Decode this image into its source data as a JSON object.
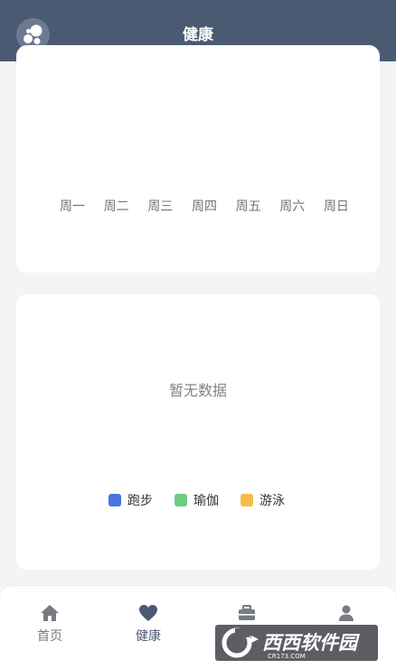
{
  "header": {
    "title": "健康",
    "logo_icon": "bubbles-logo-icon"
  },
  "weekly_chart": {
    "days": [
      "周一",
      "周二",
      "周三",
      "周四",
      "周五",
      "周六",
      "周日"
    ]
  },
  "sport_chart": {
    "empty_text": "暂无数据",
    "legend": [
      {
        "label": "跑步",
        "color": "#4a72e0"
      },
      {
        "label": "瑜伽",
        "color": "#6ccd7e"
      },
      {
        "label": "游泳",
        "color": "#f6bc45"
      }
    ]
  },
  "tabbar": {
    "items": [
      {
        "label": "首页",
        "icon": "home-icon",
        "active": false
      },
      {
        "label": "健康",
        "icon": "heart-icon",
        "active": true
      },
      {
        "label": "",
        "icon": "toolbox-icon",
        "active": false
      },
      {
        "label": "",
        "icon": "user-icon",
        "active": false
      }
    ]
  },
  "watermark": {
    "text": "西西软件园",
    "subtext": "CR173.COM"
  }
}
